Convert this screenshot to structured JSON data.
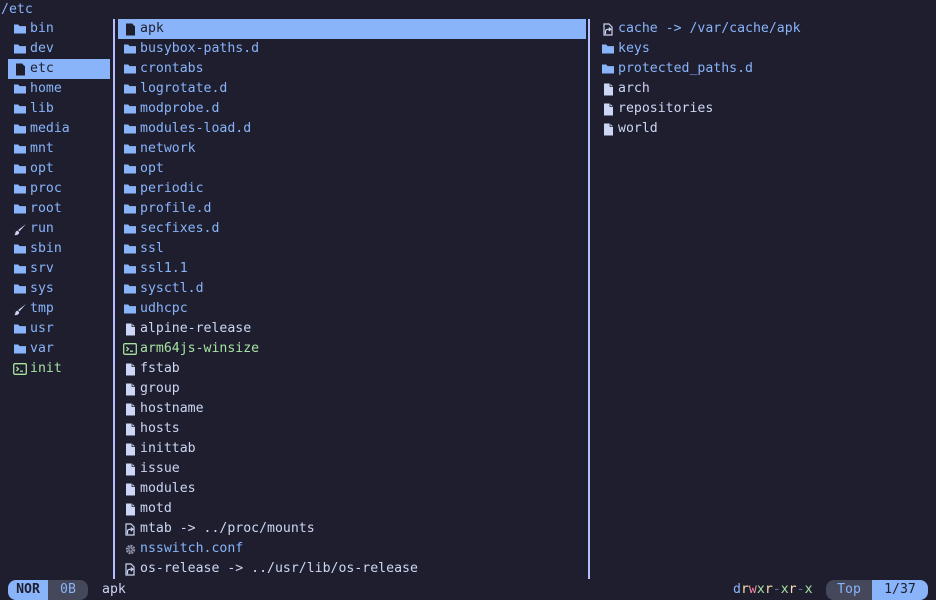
{
  "path": "/etc",
  "parent_entries": [
    {
      "name": "bin",
      "type": "dir"
    },
    {
      "name": "dev",
      "type": "dir"
    },
    {
      "name": "etc",
      "type": "file",
      "selected": true
    },
    {
      "name": "home",
      "type": "dir"
    },
    {
      "name": "lib",
      "type": "dir"
    },
    {
      "name": "media",
      "type": "dir"
    },
    {
      "name": "mnt",
      "type": "dir"
    },
    {
      "name": "opt",
      "type": "dir"
    },
    {
      "name": "proc",
      "type": "dir"
    },
    {
      "name": "root",
      "type": "dir"
    },
    {
      "name": "run",
      "type": "brush"
    },
    {
      "name": "sbin",
      "type": "dir"
    },
    {
      "name": "srv",
      "type": "dir"
    },
    {
      "name": "sys",
      "type": "dir"
    },
    {
      "name": "tmp",
      "type": "brush"
    },
    {
      "name": "usr",
      "type": "dir"
    },
    {
      "name": "var",
      "type": "dir"
    },
    {
      "name": "init",
      "type": "exec"
    }
  ],
  "current_entries": [
    {
      "name": "apk",
      "type": "file",
      "selected": true
    },
    {
      "name": "busybox-paths.d",
      "type": "dir"
    },
    {
      "name": "crontabs",
      "type": "dir"
    },
    {
      "name": "logrotate.d",
      "type": "dir"
    },
    {
      "name": "modprobe.d",
      "type": "dir"
    },
    {
      "name": "modules-load.d",
      "type": "dir"
    },
    {
      "name": "network",
      "type": "dir"
    },
    {
      "name": "opt",
      "type": "dir"
    },
    {
      "name": "periodic",
      "type": "dir"
    },
    {
      "name": "profile.d",
      "type": "dir"
    },
    {
      "name": "secfixes.d",
      "type": "dir"
    },
    {
      "name": "ssl",
      "type": "dir"
    },
    {
      "name": "ssl1.1",
      "type": "dir"
    },
    {
      "name": "sysctl.d",
      "type": "dir"
    },
    {
      "name": "udhcpc",
      "type": "dir"
    },
    {
      "name": "alpine-release",
      "type": "file"
    },
    {
      "name": "arm64js-winsize",
      "type": "exec"
    },
    {
      "name": "fstab",
      "type": "file"
    },
    {
      "name": "group",
      "type": "file"
    },
    {
      "name": "hostname",
      "type": "file"
    },
    {
      "name": "hosts",
      "type": "file"
    },
    {
      "name": "inittab",
      "type": "file"
    },
    {
      "name": "issue",
      "type": "file"
    },
    {
      "name": "modules",
      "type": "file"
    },
    {
      "name": "motd",
      "type": "file"
    },
    {
      "name": "mtab -> ../proc/mounts",
      "type": "link"
    },
    {
      "name": "nsswitch.conf",
      "type": "gear"
    },
    {
      "name": "os-release -> ../usr/lib/os-release",
      "type": "link"
    }
  ],
  "preview_entries": [
    {
      "name": "cache -> /var/cache/apk",
      "type": "linkdir"
    },
    {
      "name": "keys",
      "type": "dir"
    },
    {
      "name": "protected_paths.d",
      "type": "dir"
    },
    {
      "name": "arch",
      "type": "file"
    },
    {
      "name": "repositories",
      "type": "file"
    },
    {
      "name": "world",
      "type": "file"
    }
  ],
  "status": {
    "mode": "NOR",
    "size": "0B",
    "file": "apk",
    "permissions": [
      "d",
      "r",
      "w",
      "x",
      "r",
      "-",
      "x",
      "r",
      "-",
      "x"
    ],
    "position": "Top",
    "count": "1/37"
  },
  "colors": {
    "background": "#1e1e2e",
    "accent": "#89b4fa",
    "text": "#cdd6f4",
    "exec": "#a6e3a1"
  }
}
